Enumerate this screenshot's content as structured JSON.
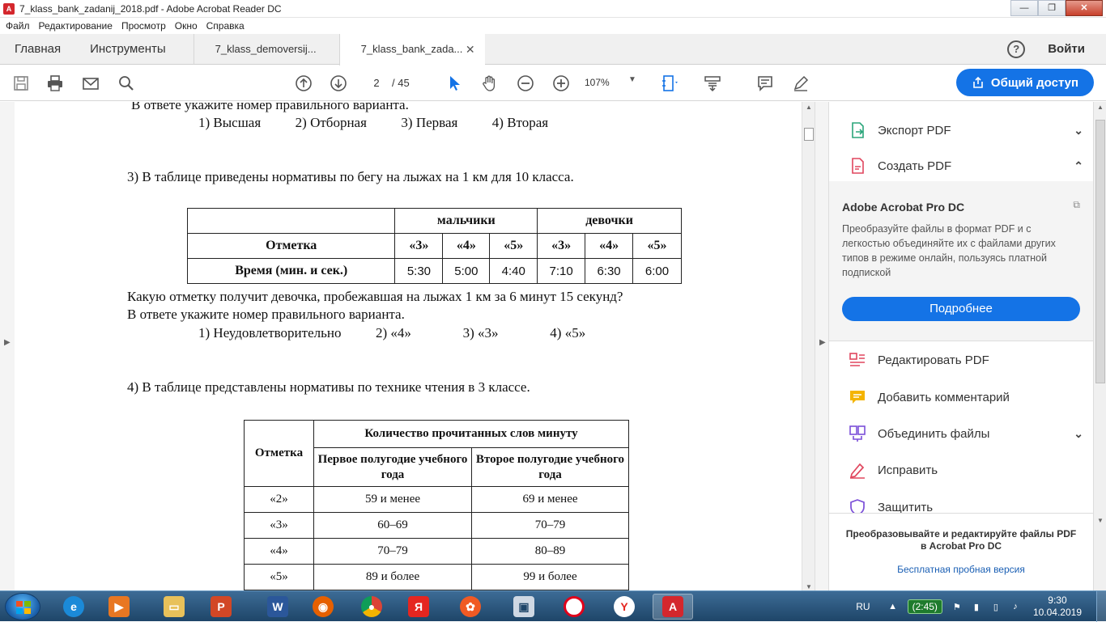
{
  "window": {
    "title": "7_klass_bank_zadanij_2018.pdf - Adobe Acrobat Reader DC",
    "minimize": "—",
    "restore": "❐",
    "close": "✕"
  },
  "menu": [
    "Файл",
    "Редактирование",
    "Просмотр",
    "Окно",
    "Справка"
  ],
  "tabs": {
    "home": "Главная",
    "tools": "Инструменты",
    "docs": [
      {
        "label": "7_klass_demoversij...",
        "active": false
      },
      {
        "label": "7_klass_bank_zada...",
        "active": true
      }
    ],
    "help": "?",
    "signin": "Войти"
  },
  "toolbar": {
    "page_current": "2",
    "page_total": "/ 45",
    "zoom": "107%",
    "share_label": "Общий доступ",
    "accent": "#1473e6"
  },
  "document": {
    "lines": [
      "В ответе укажите номер правильного варианта.",
      "1) Высшая          2) Отборная          3) Первая          4) Вторая",
      "3) В таблице приведены нормативы по бегу на лыжах на 1 км для 10 класса.",
      "Какую отметку получит девочка, пробежавшая на лыжах 1 км за 6 минут 15 секунд?",
      "В ответе укажите номер правильного варианта.",
      "1) Неудовлетворительно          2) «4»               3) «3»               4) «5»",
      "4) В таблице представлены нормативы по технике чтения в 3 классе."
    ],
    "table1": {
      "group_headers": [
        "мальчики",
        "девочки"
      ],
      "row_mark_label": "Отметка",
      "marks": [
        "«3»",
        "«4»",
        "«5»",
        "«3»",
        "«4»",
        "«5»"
      ],
      "row_time_label": "Время (мин. и сек.)",
      "times": [
        "5:30",
        "5:00",
        "4:40",
        "7:10",
        "6:30",
        "6:00"
      ]
    },
    "table2": {
      "mark_header": "Отметка",
      "group_header": "Количество прочитанных слов минуту",
      "col1": "Первое полугодие учебного года",
      "col2": "Второе полугодие учебного года",
      "rows": [
        [
          "«2»",
          "59 и менее",
          "69 и менее"
        ],
        [
          "«3»",
          "60–69",
          "70–79"
        ],
        [
          "«4»",
          "70–79",
          "80–89"
        ],
        [
          "«5»",
          "89 и более",
          "99 и более"
        ]
      ]
    }
  },
  "right_panel": {
    "export": "Экспорт PDF",
    "create": "Создать PDF",
    "pro_title": "Adobe Acrobat Pro DC",
    "pro_desc": "Преобразуйте файлы в формат PDF и с\nлегкостью объединяйте их с файлами других\nтипов в режиме онлайн, пользуясь платной\nподпиской",
    "pro_button": "Подробнее",
    "tools": [
      {
        "label": "Редактировать PDF",
        "icon": "edit-pdf-icon",
        "color": "#e0465e"
      },
      {
        "label": "Добавить комментарий",
        "icon": "comment-icon",
        "color": "#f4b400"
      },
      {
        "label": "Объединить файлы",
        "icon": "combine-icon",
        "color": "#7b4fd8"
      },
      {
        "label": "Исправить",
        "icon": "fill-sign-icon",
        "color": "#e0465e"
      },
      {
        "label": "Защитить",
        "icon": "protect-icon",
        "color": "#7b4fd8"
      }
    ],
    "footer_promo": "Преобразовывайте и редактируйте файлы PDF\nв Acrobat Pro DC",
    "footer_trial": "Бесплатная пробная версия"
  },
  "taskbar": {
    "lang": "RU",
    "battery": "(2:45)",
    "time": "9:30",
    "date": "10.04.2019"
  }
}
